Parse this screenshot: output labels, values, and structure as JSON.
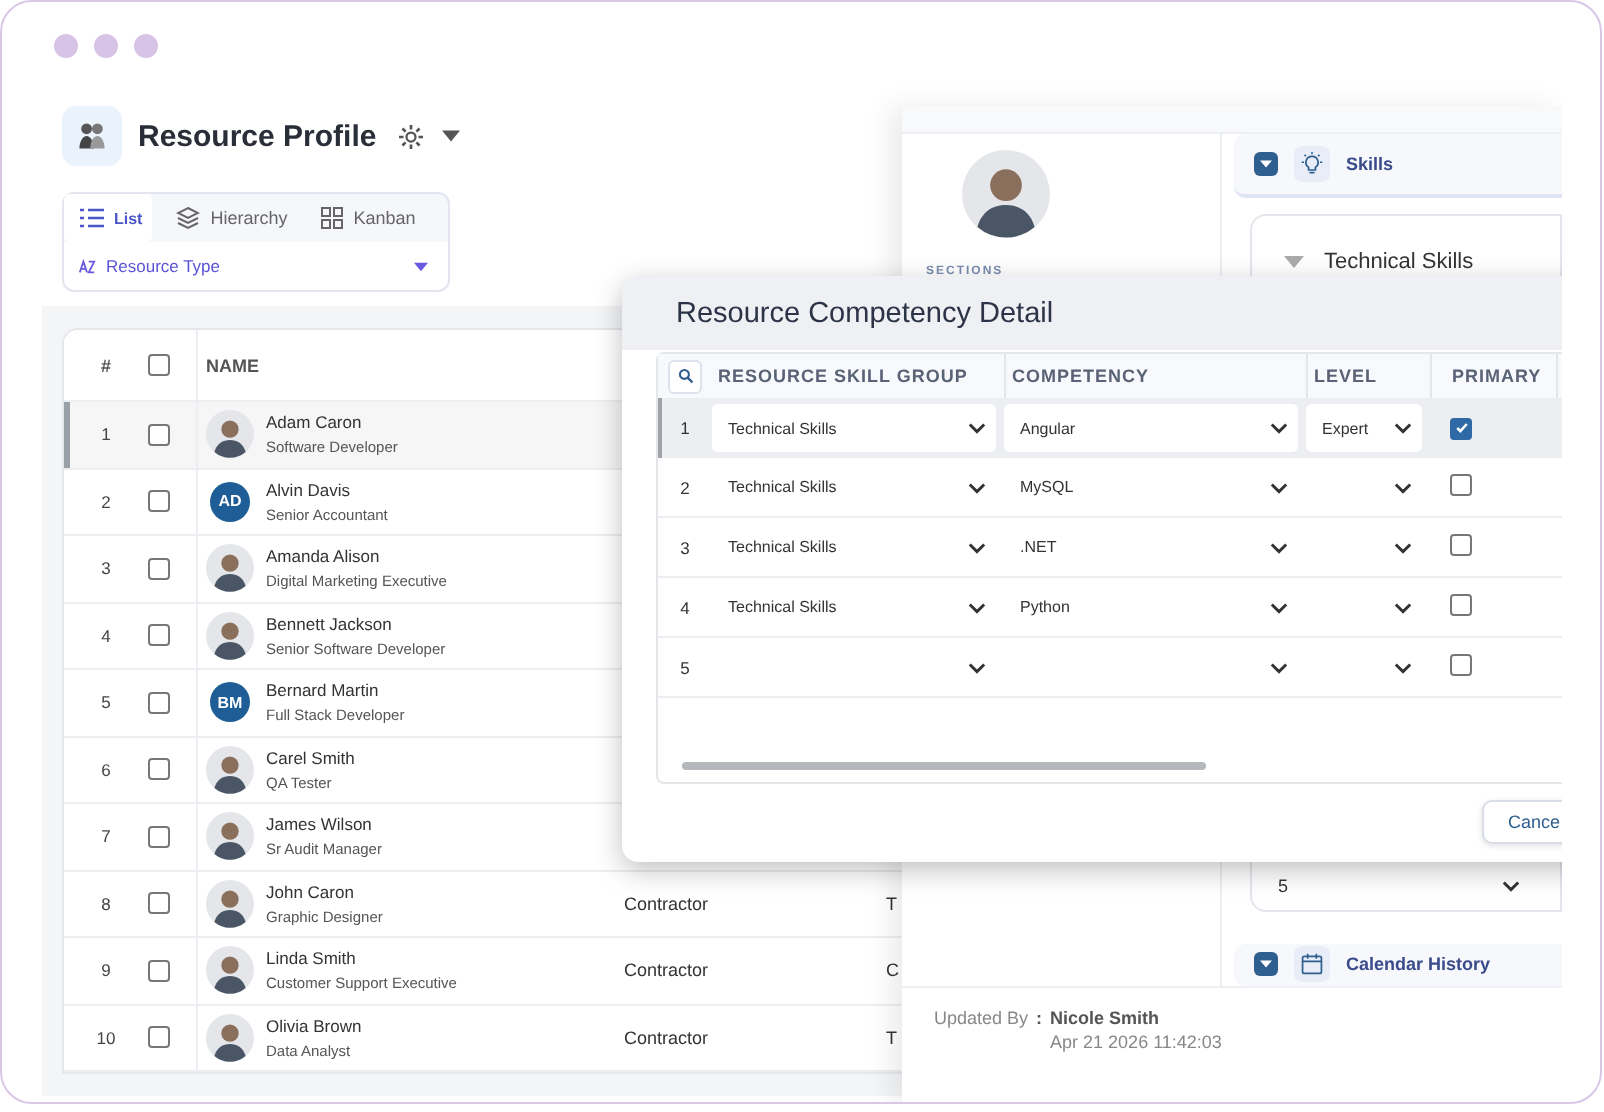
{
  "app_header": {
    "title": "Resource Profile"
  },
  "view_tabs": [
    {
      "kind": "list",
      "label": "List",
      "selected": true
    },
    {
      "kind": "hierarchy",
      "label": "Hierarchy",
      "selected": false
    },
    {
      "kind": "kanban",
      "label": "Kanban",
      "selected": false
    }
  ],
  "group_by": {
    "value": "Resource Type"
  },
  "table": {
    "columns": [
      "#",
      "NAME"
    ],
    "header_checked": false,
    "rows": [
      {
        "number": "1",
        "name": "Adam Caron",
        "role": "Software Developer",
        "avatar": {
          "kind": "photo"
        },
        "checked": false,
        "selected": true
      },
      {
        "number": "2",
        "name": "Alvin Davis",
        "role": "Senior Accountant",
        "avatar": {
          "kind": "initials",
          "text": "AD"
        },
        "checked": false,
        "selected": false
      },
      {
        "number": "3",
        "name": "Amanda Alison",
        "role": "Digital Marketing Executive",
        "avatar": {
          "kind": "photo"
        },
        "checked": false,
        "selected": false
      },
      {
        "number": "4",
        "name": "Bennett Jackson",
        "role": "Senior Software Developer",
        "avatar": {
          "kind": "photo"
        },
        "checked": false,
        "selected": false
      },
      {
        "number": "5",
        "name": "Bernard Martin",
        "role": "Full Stack Developer",
        "avatar": {
          "kind": "initials",
          "text": "BM"
        },
        "checked": false,
        "selected": false
      },
      {
        "number": "6",
        "name": "Carel Smith",
        "role": "QA Tester",
        "avatar": {
          "kind": "photo"
        },
        "checked": false,
        "selected": false
      },
      {
        "number": "7",
        "name": "James Wilson",
        "role": "Sr Audit Manager",
        "avatar": {
          "kind": "photo"
        },
        "checked": false,
        "selected": false
      },
      {
        "number": "8",
        "name": "John Caron",
        "role": "Graphic Designer",
        "avatar": {
          "kind": "photo"
        },
        "checked": false,
        "selected": false,
        "type": "Contractor",
        "column_4": "T"
      },
      {
        "number": "9",
        "name": "Linda Smith",
        "role": "Customer Support Executive",
        "avatar": {
          "kind": "photo"
        },
        "checked": false,
        "selected": false,
        "type": "Contractor",
        "column_4": "C"
      },
      {
        "number": "10",
        "name": "Olivia Brown",
        "role": "Data Analyst",
        "avatar": {
          "kind": "photo"
        },
        "checked": false,
        "selected": false,
        "type": "Contractor",
        "column_4": "T"
      }
    ]
  },
  "detail_panel": {
    "sections_label": "SECTIONS",
    "skills_section": {
      "title": "Skills",
      "expanded": true
    },
    "skill_group": {
      "title": "Technical Skills"
    },
    "level_rows": [
      "5"
    ],
    "calendar_section": {
      "title": "Calendar History",
      "expanded": true
    },
    "footer": {
      "updated_by_label": "Updated By",
      "separator": ":",
      "updated_by": "Nicole Smith",
      "updated_at": "Apr 21 2026 11:42:03"
    }
  },
  "dialog": {
    "title": "Resource Competency Detail",
    "columns": [
      "RESOURCE SKILL GROUP",
      "COMPETENCY",
      "LEVEL",
      "PRIMARY"
    ],
    "rows": [
      {
        "number": "1",
        "skill_group": "Technical Skills",
        "competency": "Angular",
        "level": "Expert",
        "primary": true,
        "selected": true
      },
      {
        "number": "2",
        "skill_group": "Technical Skills",
        "competency": "MySQL",
        "primary": false,
        "selected": false
      },
      {
        "number": "3",
        "skill_group": "Technical Skills",
        "competency": ".NET",
        "primary": false,
        "selected": false
      },
      {
        "number": "4",
        "skill_group": "Technical Skills",
        "competency": "Python",
        "primary": false,
        "selected": false
      },
      {
        "number": "5",
        "primary": false,
        "selected": false
      }
    ],
    "cancel_button": "Cance"
  }
}
